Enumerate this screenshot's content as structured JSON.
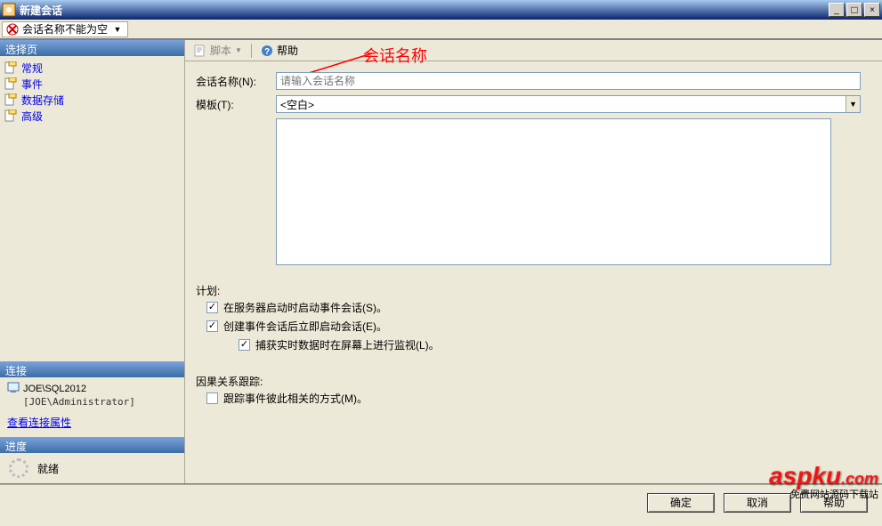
{
  "window": {
    "title": "新建会话",
    "min_tooltip": "Minimize",
    "max_tooltip": "Maximize",
    "close_tooltip": "Close"
  },
  "error": {
    "message": "会话名称不能为空"
  },
  "sidebar": {
    "select_page_header": "选择页",
    "items": [
      {
        "icon": "doc",
        "label": "常规"
      },
      {
        "icon": "doc",
        "label": "事件"
      },
      {
        "icon": "doc",
        "label": "数据存储"
      },
      {
        "icon": "doc",
        "label": "高级"
      }
    ],
    "connection_header": "连接",
    "connection_server": "JOE\\SQL2012",
    "connection_user": "[JOE\\Administrator]",
    "view_connection_props": "查看连接属性",
    "progress_header": "进度",
    "progress_status": "就绪"
  },
  "toolbar": {
    "script_label": "脚本",
    "help_label": "帮助"
  },
  "annotation": {
    "session_name": "会话名称"
  },
  "form": {
    "session_name_label": "会话名称(N):",
    "session_name_placeholder": "请输入会话名称",
    "template_label": "模板(T):",
    "template_value": "<空白>",
    "plan_label": "计划:",
    "plan_opt1": "在服务器启动时启动事件会话(S)。",
    "plan_opt2": "创建事件会话后立即启动会话(E)。",
    "plan_opt3": "捕获实时数据时在屏幕上进行监视(L)。",
    "causality_label": "因果关系跟踪:",
    "causality_opt": "跟踪事件彼此相关的方式(M)。"
  },
  "buttons": {
    "ok": "确定",
    "cancel": "取消",
    "help": "帮助"
  },
  "watermark": {
    "text": "aspku",
    "suffix": ".com",
    "sub": "免费网站源码下载站"
  }
}
